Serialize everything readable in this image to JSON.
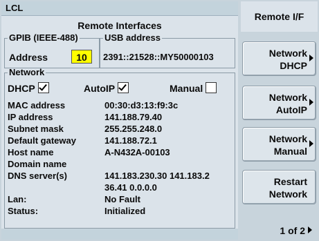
{
  "header": {
    "title": "LCL"
  },
  "main": {
    "heading": "Remote Interfaces",
    "gpib": {
      "legend": "GPIB (IEEE-488)",
      "address_label": "Address",
      "address_value": "10"
    },
    "usb": {
      "legend": "USB address",
      "value": "2391::21528::MY50000103"
    },
    "network": {
      "legend": "Network",
      "dhcp": {
        "label": "DHCP",
        "checked": true
      },
      "autoip": {
        "label": "AutoIP",
        "checked": true
      },
      "manual": {
        "label": "Manual",
        "checked": false
      },
      "rows": [
        {
          "key": "MAC address",
          "value": "00:30:d3:13:f9:3c"
        },
        {
          "key": "IP address",
          "value": "141.188.79.40"
        },
        {
          "key": "Subnet mask",
          "value": "255.255.248.0"
        },
        {
          "key": "Default gateway",
          "value": "141.188.72.1"
        },
        {
          "key": "Host name",
          "value": "A-N432A-00103"
        },
        {
          "key": "Domain name",
          "value": ""
        },
        {
          "key": "DNS server(s)",
          "value": "141.183.230.30  141.183.2"
        },
        {
          "key": "",
          "value": "36.41  0.0.0.0"
        },
        {
          "key": "Lan:",
          "value": "No Fault"
        },
        {
          "key": "Status:",
          "value": "Initialized"
        }
      ]
    }
  },
  "menu": {
    "title": "Remote I/F",
    "softkeys": [
      {
        "line1": "Network",
        "line2": "DHCP",
        "arrow": true
      },
      {
        "line1": "Network",
        "line2": "AutoIP",
        "arrow": true
      },
      {
        "line1": "Network",
        "line2": "Manual",
        "arrow": true
      },
      {
        "line1": "Restart",
        "line2": "Network",
        "arrow": false
      }
    ],
    "pager": "1 of 2"
  },
  "colors": {
    "highlight": "#ffff00",
    "background": "#c8d4dc",
    "panel": "#dbe3ea"
  }
}
